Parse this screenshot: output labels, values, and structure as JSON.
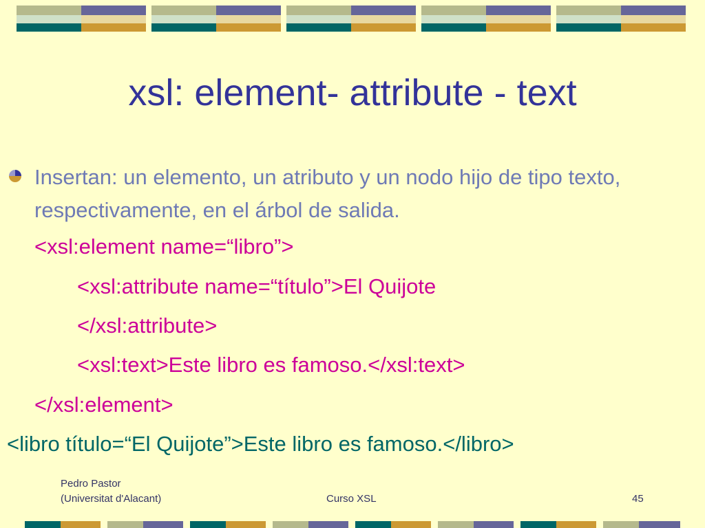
{
  "slide": {
    "title": "xsl: element- attribute - text",
    "bullet": "Insertan: un elemento, un atributo y un nodo hijo de tipo texto, respectivamente, en el árbol de salida.",
    "code_lines": [
      "<xsl:element name=“libro”>",
      "<xsl:attribute name=“título”>El Quijote",
      "</xsl:attribute>",
      "<xsl:text>Este libro es famoso.</xsl:text>",
      "</xsl:element>"
    ],
    "result_line": "<libro título=“El Quijote”>Este libro es famoso.</libro>"
  },
  "footer": {
    "author": "Pedro Pastor",
    "institution": "(Universitat d'Alacant)",
    "course": "Curso XSL",
    "page_number": "45"
  },
  "colors": {
    "background": "#ffffcc",
    "title": "#333399",
    "bullet_text": "#6e7ab5",
    "code": "#cc0099",
    "result": "#006666",
    "deco_teal": "#006666",
    "deco_purple": "#666699",
    "deco_gold": "#cc9933",
    "deco_sage": "#b5b98c"
  }
}
